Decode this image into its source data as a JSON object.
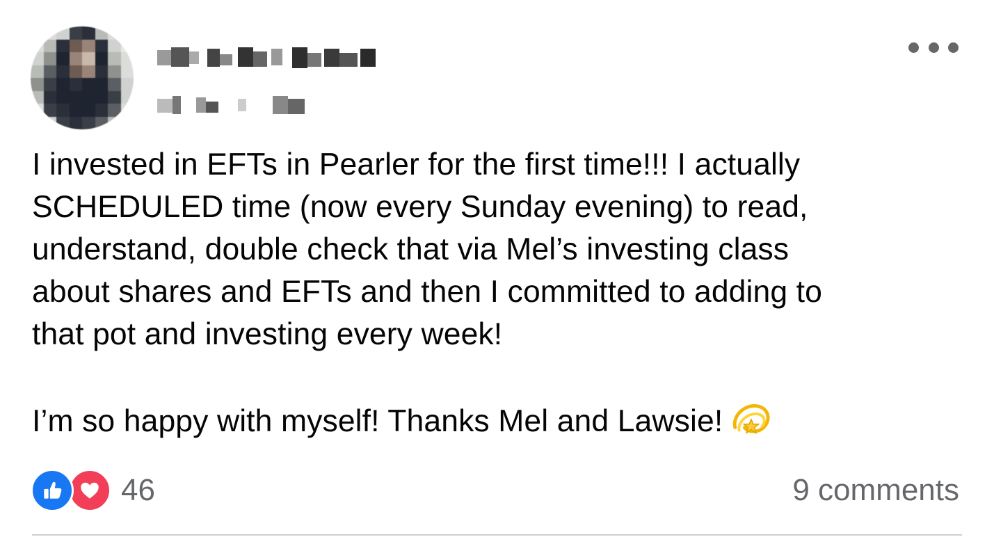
{
  "post": {
    "author_name": "",
    "meta": "",
    "more_label": "More options",
    "paragraphs": [
      "I invested in EFTs in Pearler for the first time!!! I actually\nSCHEDULED time (now every Sunday evening) to read,\nunderstand, double check that via Mel’s investing class\nabout shares and EFTs and then I committed to adding to\nthat pot and investing every week!",
      "I’m so happy with myself! Thanks Mel and Lawsie!"
    ],
    "emoji": "dizzy-emoji"
  },
  "footer": {
    "reaction_count": "46",
    "comments": "9 comments",
    "reaction_icons": [
      "like-icon",
      "love-icon"
    ]
  },
  "colors": {
    "like": "#1877f2",
    "love": "#f33e58",
    "secondary_text": "#65676b",
    "divider": "#ced0d4"
  }
}
